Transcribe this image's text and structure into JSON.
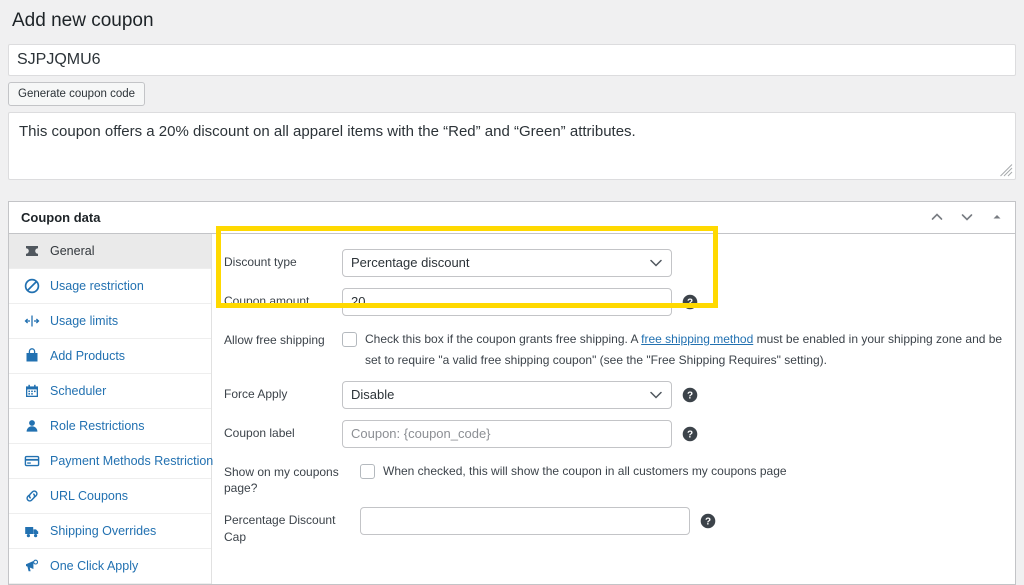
{
  "page": {
    "title": "Add new coupon"
  },
  "coupon_code": {
    "value": "SJPJQMU6",
    "generate_label": "Generate coupon code"
  },
  "description": {
    "value": "This coupon offers a 20% discount on all apparel items with the “Red” and “Green” attributes."
  },
  "panel": {
    "title": "Coupon data",
    "actions": [
      {
        "name": "move-up-icon",
        "label": "Move up"
      },
      {
        "name": "move-down-icon",
        "label": "Move down"
      },
      {
        "name": "toggle-panel-icon",
        "label": "Toggle panel"
      }
    ],
    "tabs": [
      {
        "label": "General",
        "icon": "ticket-icon",
        "active": true
      },
      {
        "label": "Usage restriction",
        "icon": "no-entry-icon",
        "active": false
      },
      {
        "label": "Usage limits",
        "icon": "usage-limits-icon",
        "active": false
      },
      {
        "label": "Add Products",
        "icon": "products-bag-icon",
        "active": false
      },
      {
        "label": "Scheduler",
        "icon": "calendar-icon",
        "active": false
      },
      {
        "label": "Role Restrictions",
        "icon": "user-icon",
        "active": false
      },
      {
        "label": "Payment Methods Restriction",
        "icon": "credit-card-icon",
        "active": false
      },
      {
        "label": "URL Coupons",
        "icon": "link-icon",
        "active": false
      },
      {
        "label": "Shipping Overrides",
        "icon": "truck-icon",
        "active": false
      },
      {
        "label": "One Click Apply",
        "icon": "megaphone-icon",
        "active": false
      }
    ]
  },
  "fields": {
    "discount_type": {
      "label": "Discount type",
      "value": "Percentage discount"
    },
    "coupon_amount": {
      "label": "Coupon amount",
      "value": "20"
    },
    "allow_free_shipping": {
      "label": "Allow free shipping",
      "checked": false,
      "text_before": "Check this box if the coupon grants free shipping. A ",
      "link_text": "free shipping method",
      "text_after": " must be enabled in your shipping zone and be set to require \"a valid free shipping coupon\" (see the \"Free Shipping Requires\" setting)."
    },
    "force_apply": {
      "label": "Force Apply",
      "value": "Disable"
    },
    "coupon_label": {
      "label": "Coupon label",
      "value": "",
      "placeholder": "Coupon: {coupon_code}"
    },
    "show_on_coupons_page": {
      "label": "Show on my coupons page?",
      "checked": false,
      "text": "When checked, this will show the coupon in all customers my coupons page"
    },
    "percentage_discount_cap": {
      "label": "Percentage Discount Cap",
      "value": ""
    }
  },
  "colors": {
    "highlight": "#ffd900",
    "link": "#2271b1",
    "icon_blue": "#2271b1"
  }
}
